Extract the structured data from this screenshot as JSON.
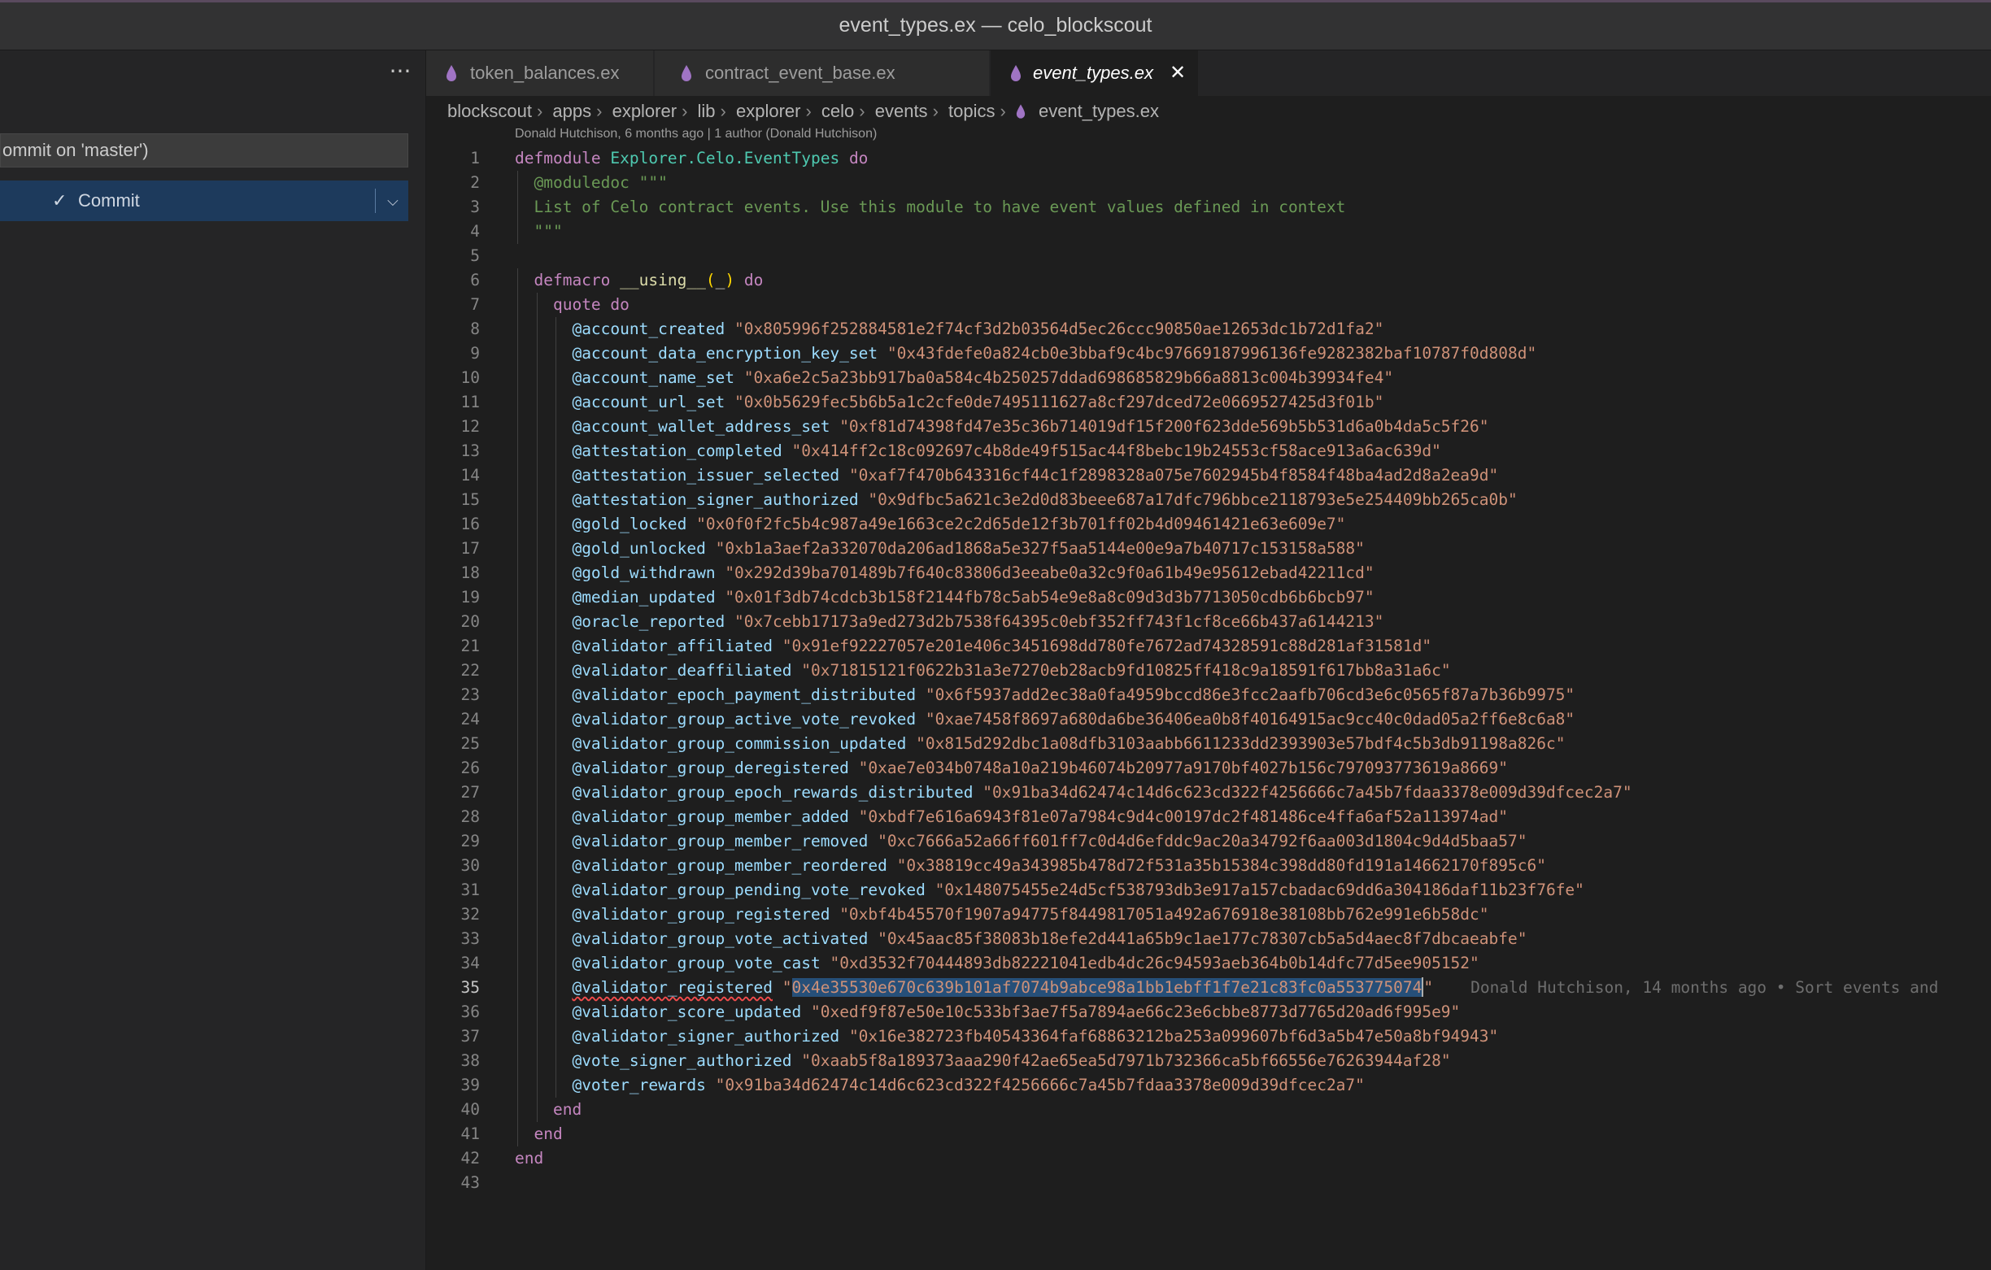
{
  "window": {
    "title": "event_types.ex — celo_blockscout"
  },
  "sidebar": {
    "more_glyph": "···",
    "commit_message_placeholder": "ommit on 'master')",
    "commit_button_label": "Commit"
  },
  "tabs": [
    {
      "label": "token_balances.ex",
      "active": false
    },
    {
      "label": "contract_event_base.ex",
      "active": false
    },
    {
      "label": "event_types.ex",
      "active": true
    }
  ],
  "breadcrumb": [
    "blockscout",
    "apps",
    "explorer",
    "lib",
    "explorer",
    "celo",
    "events",
    "topics",
    "event_types.ex"
  ],
  "codelens": "Donald Hutchison, 6 months ago | 1 author (Donald Hutchison)",
  "editor": {
    "current_line": 35,
    "language_icon_color": "#a074c4",
    "lines": [
      "defmodule Explorer.Celo.EventTypes do",
      "  @moduledoc \"\"\"",
      "  List of Celo contract events. Use this module to have event values defined in context",
      "  \"\"\"",
      "",
      "  defmacro __using__(_) do",
      "    quote do",
      "      @account_created \"0x805996f252884581e2f74cf3d2b03564d5ec26ccc90850ae12653dc1b72d1fa2\"",
      "      @account_data_encryption_key_set \"0x43fdefe0a824cb0e3bbaf9c4bc97669187996136fe9282382baf10787f0d808d\"",
      "      @account_name_set \"0xa6e2c5a23bb917ba0a584c4b250257ddad698685829b66a8813c004b39934fe4\"",
      "      @account_url_set \"0x0b5629fec5b6b5a1c2cfe0de7495111627a8cf297dced72e0669527425d3f01b\"",
      "      @account_wallet_address_set \"0xf81d74398fd47e35c36b714019df15f200f623dde569b5b531d6a0b4da5c5f26\"",
      "      @attestation_completed \"0x414ff2c18c092697c4b8de49f515ac44f8bebc19b24553cf58ace913a6ac639d\"",
      "      @attestation_issuer_selected \"0xaf7f470b643316cf44c1f2898328a075e7602945b4f8584f48ba4ad2d8a2ea9d\"",
      "      @attestation_signer_authorized \"0x9dfbc5a621c3e2d0d83beee687a17dfc796bbce2118793e5e254409bb265ca0b\"",
      "      @gold_locked \"0x0f0f2fc5b4c987a49e1663ce2c2d65de12f3b701ff02b4d09461421e63e609e7\"",
      "      @gold_unlocked \"0xb1a3aef2a332070da206ad1868a5e327f5aa5144e00e9a7b40717c153158a588\"",
      "      @gold_withdrawn \"0x292d39ba701489b7f640c83806d3eeabe0a32c9f0a61b49e95612ebad42211cd\"",
      "      @median_updated \"0x01f3db74cdcb3b158f2144fb78c5ab54e9e8a8c09d3d3b7713050cdb6b6bcb97\"",
      "      @oracle_reported \"0x7cebb17173a9ed273d2b7538f64395c0ebf352ff743f1cf8ce66b437a6144213\"",
      "      @validator_affiliated \"0x91ef92227057e201e406c3451698dd780fe7672ad74328591c88d281af31581d\"",
      "      @validator_deaffiliated \"0x71815121f0622b31a3e7270eb28acb9fd10825ff418c9a18591f617bb8a31a6c\"",
      "      @validator_epoch_payment_distributed \"0x6f5937add2ec38a0fa4959bccd86e3fcc2aafb706cd3e6c0565f87a7b36b9975\"",
      "      @validator_group_active_vote_revoked \"0xae7458f8697a680da6be36406ea0b8f40164915ac9cc40c0dad05a2ff6e8c6a8\"",
      "      @validator_group_commission_updated \"0x815d292dbc1a08dfb3103aabb6611233dd2393903e57bdf4c5b3db91198a826c\"",
      "      @validator_group_deregistered \"0xae7e034b0748a10a219b46074b20977a9170bf4027b156c797093773619a8669\"",
      "      @validator_group_epoch_rewards_distributed \"0x91ba34d62474c14d6c623cd322f4256666c7a45b7fdaa3378e009d39dfcec2a7\"",
      "      @validator_group_member_added \"0xbdf7e616a6943f81e07a7984c9d4c00197dc2f481486ce4ffa6af52a113974ad\"",
      "      @validator_group_member_removed \"0xc7666a52a66ff601ff7c0d4d6efddc9ac20a34792f6aa003d1804c9d4d5baa57\"",
      "      @validator_group_member_reordered \"0x38819cc49a343985b478d72f531a35b15384c398dd80fd191a14662170f895c6\"",
      "      @validator_group_pending_vote_revoked \"0x148075455e24d5cf538793db3e917a157cbadac69dd6a304186daf11b23f76fe\"",
      "      @validator_group_registered \"0xbf4b45570f1907a94775f8449817051a492a676918e38108bb762e991e6b58dc\"",
      "      @validator_group_vote_activated \"0x45aac85f38083b18efe2d441a65b9c1ae177c78307cb5a5d4aec8f7dbcaeabfe\"",
      "      @validator_group_vote_cast \"0xd3532f70444893db82221041edb4dc26c94593aeb364b0b14dfc77d5ee905152\"",
      "      @validator_registered \"0x4e35530e670c639b101af7074b9abce98a1bb1ebff1f7e21c83fc0a553775074\"",
      "      @validator_score_updated \"0xedf9f87e50e10c533bf3ae7f5a7894ae66c23e6cbbe8773d7765d20ad6f995e9\"",
      "      @validator_signer_authorized \"0x16e382723fb40543364faf68863212ba253a099607bf6d3a5b47e50a8bf94943\"",
      "      @vote_signer_authorized \"0xaab5f8a189373aaa290f42ae65ea5d7971b732366ca5bf66556e76263944af28\"",
      "      @voter_rewards \"0x91ba34d62474c14d6c623cd322f4256666c7a45b7fdaa3378e009d39dfcec2a7\"",
      "    end",
      "  end",
      "end",
      ""
    ],
    "inline_blame": "Donald Hutchison, 14 months ago • Sort events and"
  }
}
